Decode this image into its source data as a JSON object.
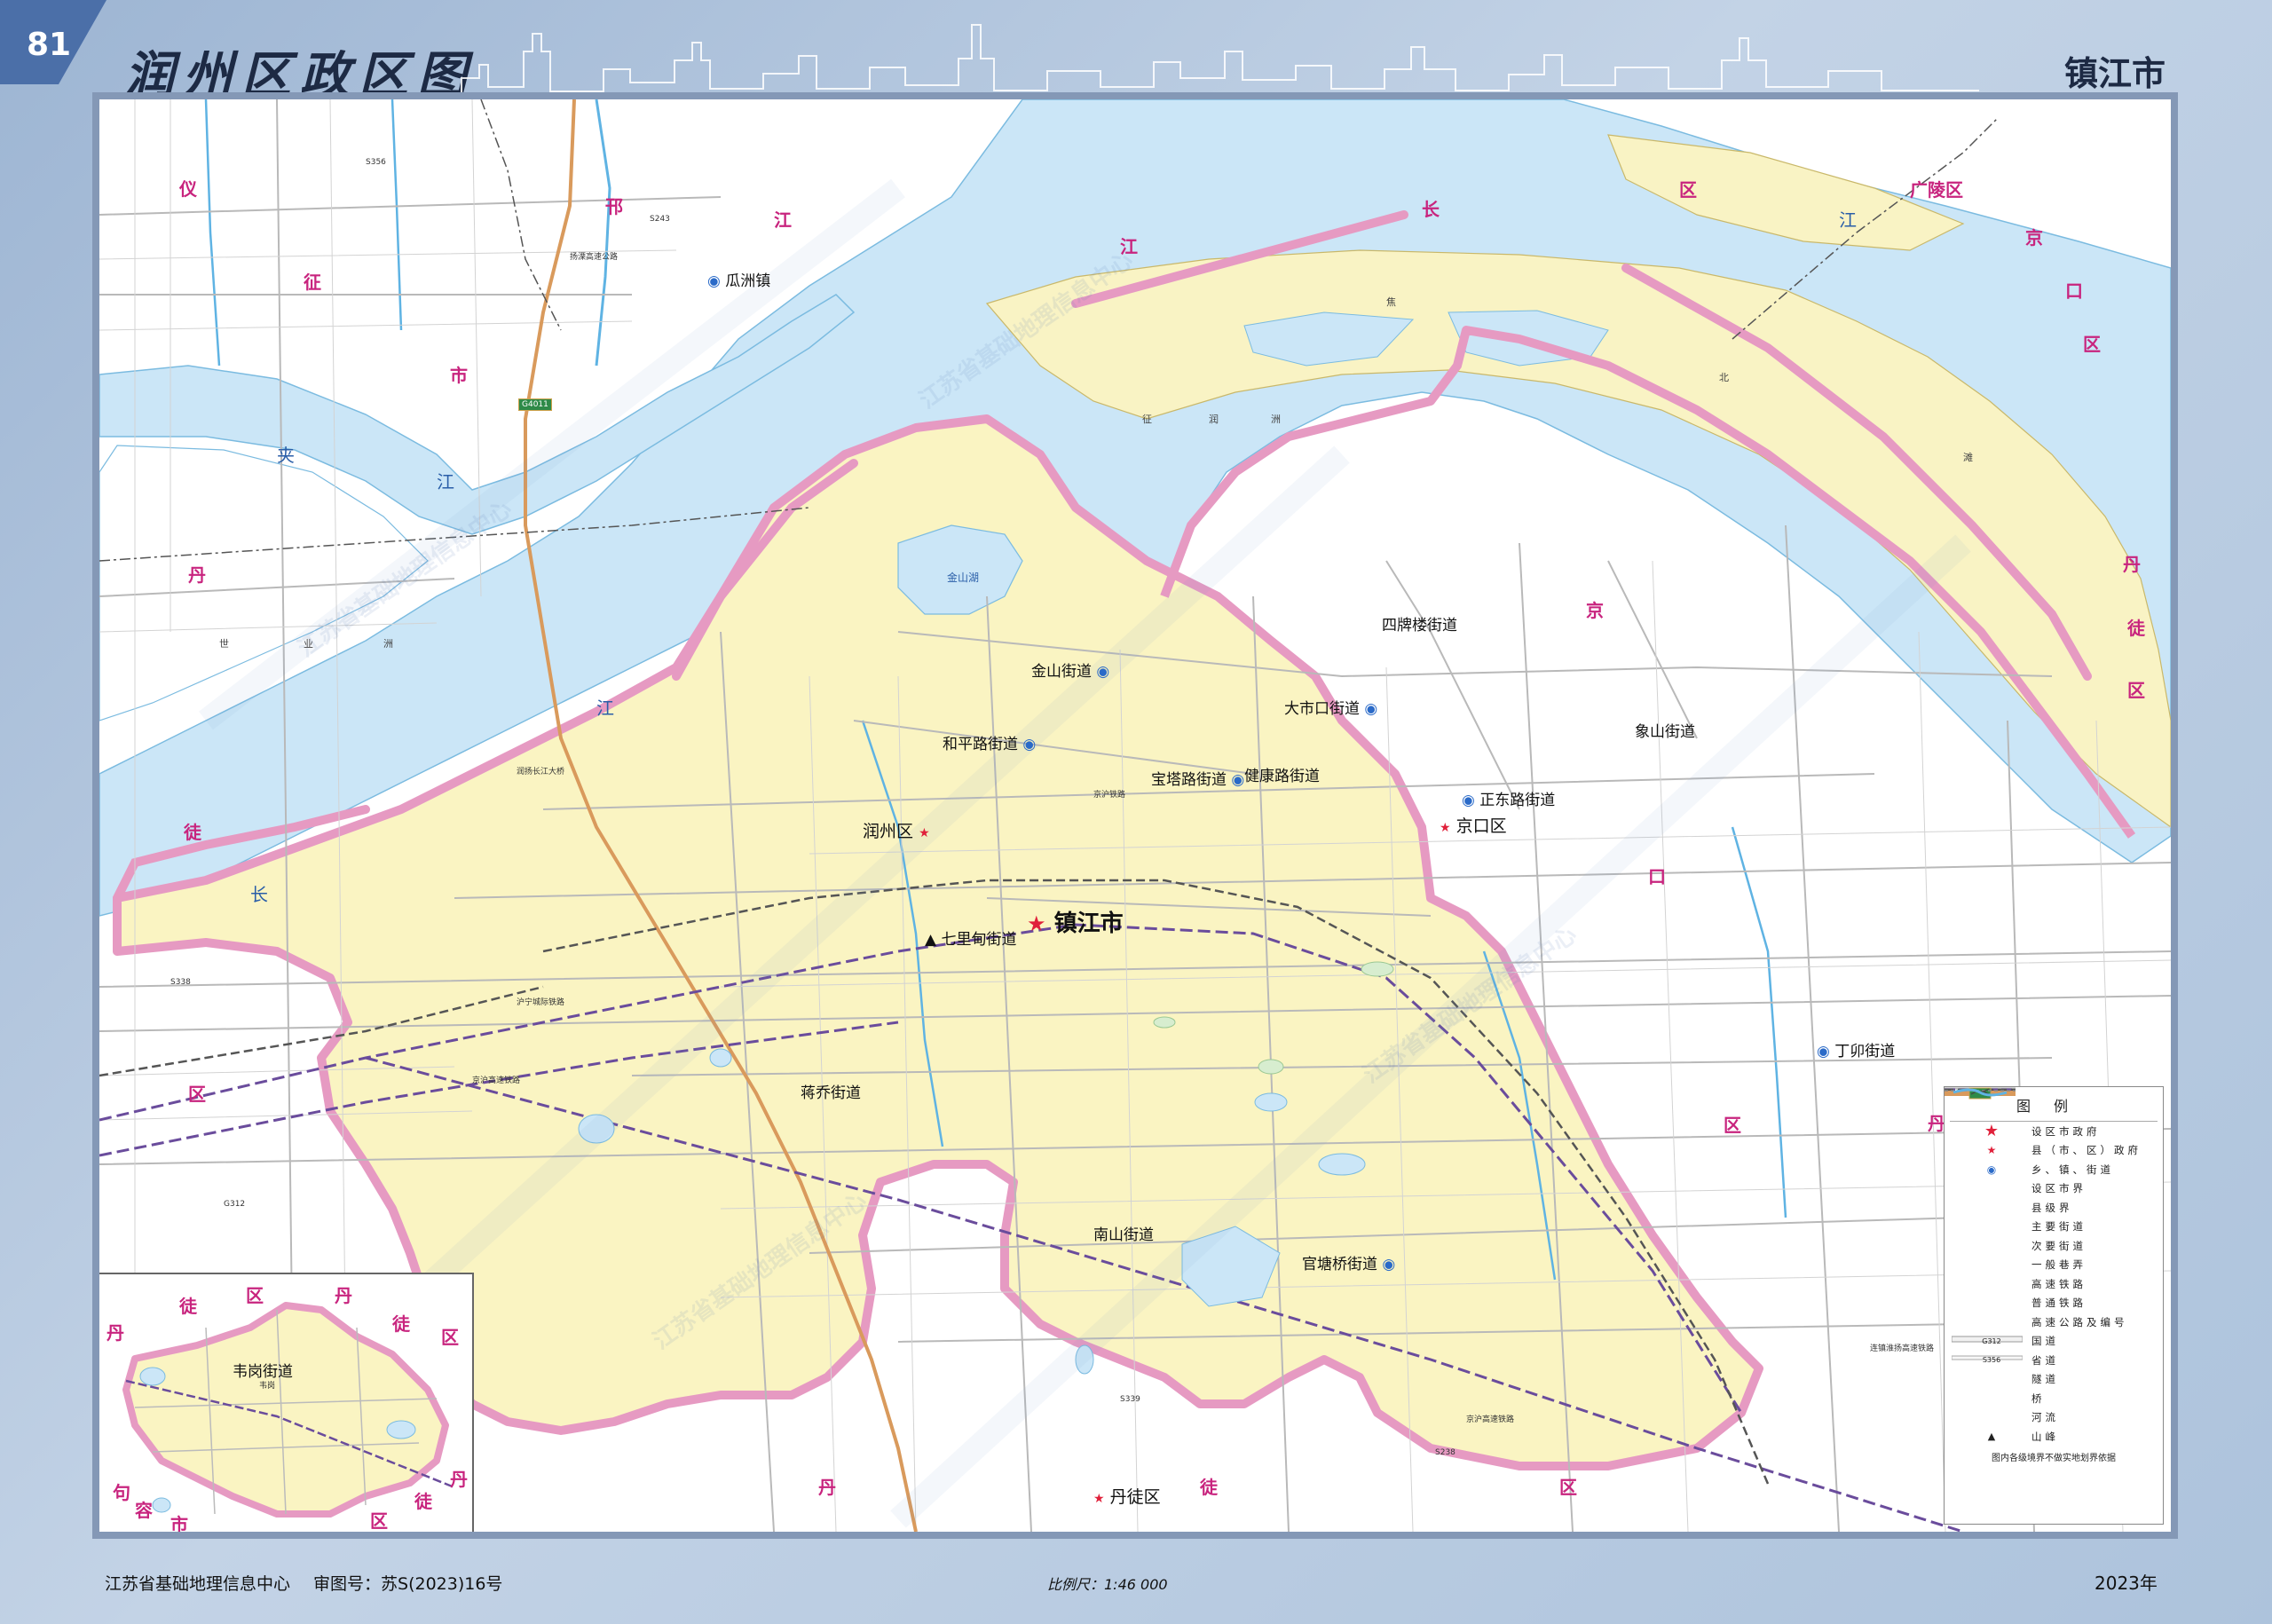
{
  "page": {
    "number": "81",
    "title": "润州区政区图",
    "city": "镇江市"
  },
  "colors": {
    "water": "#cbe6f7",
    "district_fill": "#faf4c2",
    "shoal_fill": "#f9f3c4",
    "boundary_pink": "#e69ac2",
    "label_magenta": "#c8247e",
    "river_blue": "#5fb3e3",
    "highway": "#d99a5c"
  },
  "labels": {
    "district_seat": "润州区",
    "city_seat": "镇江市",
    "jingkou": "京口区",
    "dantu": "丹徒区",
    "subdistricts": [
      "金山街道",
      "和平路街道",
      "宝塔路街道",
      "七里甸街道",
      "蒋乔街道",
      "南山街道",
      "官塘桥街道"
    ],
    "jingkou_subdistricts": [
      "四牌楼街道",
      "大市口街道",
      "健康路街道",
      "正东路街道",
      "象山街道",
      "丁卯街道"
    ],
    "town": "瓜洲镇",
    "jiangdu_chars": [
      "江",
      "长",
      "区"
    ],
    "guangling": "广陵区",
    "jingkou_outer": [
      "京",
      "口",
      "区"
    ],
    "yizheng": [
      "仪",
      "征",
      "市"
    ],
    "hanjiang": [
      "邗",
      "江"
    ],
    "dantu_west": [
      "丹",
      "徒",
      "区"
    ],
    "jingkou_mid": [
      "京",
      "口"
    ],
    "jingkou_south": [
      "区"
    ],
    "dantu_south": [
      "丹",
      "徒",
      "区"
    ],
    "dantu_east": [
      "丹",
      "徒",
      "区"
    ],
    "jingkou_east": [
      "丹"
    ],
    "water_labels": [
      "夹",
      "江",
      "长",
      "江",
      "江",
      "金山湖",
      "征",
      "润",
      "洲",
      "北",
      "滩"
    ],
    "shoal_labels": [
      "世",
      "业",
      "洲",
      "焦"
    ],
    "roads": [
      "S356",
      "S338",
      "S243",
      "G312",
      "S238",
      "S339",
      "沪宁城际铁路",
      "京沪铁路",
      "京沪高速铁路",
      "连镇淮扬高速铁路",
      "京沪高速铁路",
      "扬溧高速公路",
      "润扬长江大桥"
    ],
    "highway_shield": "G4011"
  },
  "inset": {
    "subdistrict": "韦岗街道",
    "town_small": "韦岗",
    "chars": [
      "徒",
      "区",
      "丹",
      "丹",
      "徒",
      "区",
      "句",
      "容",
      "市",
      "丹",
      "徒",
      "区"
    ]
  },
  "legend": {
    "title": "图例",
    "items": [
      {
        "symbol": "star-big",
        "label": "设区市政府"
      },
      {
        "symbol": "star-small",
        "label": "县（市、区）政府"
      },
      {
        "symbol": "circle-dot",
        "label": "乡、镇、街道"
      },
      {
        "symbol": "line-shi",
        "label": "设区市界"
      },
      {
        "symbol": "line-xian",
        "label": "县级界"
      },
      {
        "symbol": "road-major",
        "label": "主要街道"
      },
      {
        "symbol": "road-minor",
        "label": "次要街道"
      },
      {
        "symbol": "road-lane",
        "label": "一般巷弄"
      },
      {
        "symbol": "rail-high",
        "label": "高速铁路"
      },
      {
        "symbol": "rail-normal",
        "label": "普通铁路"
      },
      {
        "symbol": "expressway",
        "label": "高速公路及编号"
      },
      {
        "symbol": "national-road",
        "label": "国道"
      },
      {
        "symbol": "provincial-road",
        "label": "省道"
      },
      {
        "symbol": "tunnel",
        "label": "隧道"
      },
      {
        "symbol": "bridge",
        "label": "桥"
      },
      {
        "symbol": "river",
        "label": "河流"
      },
      {
        "symbol": "peak",
        "label": "山峰"
      }
    ],
    "road_codes": {
      "national": "G312",
      "provincial": "S356",
      "expressway": "G4011"
    },
    "note": "图内各级境界不做实地划界依据"
  },
  "footer": {
    "publisher": "江苏省基础地理信息中心",
    "approval": "审图号：苏S(2023)16号",
    "scale": "比例尺：1:46 000",
    "year": "2023年"
  },
  "watermark_text": "江苏省基础地理信息中心"
}
